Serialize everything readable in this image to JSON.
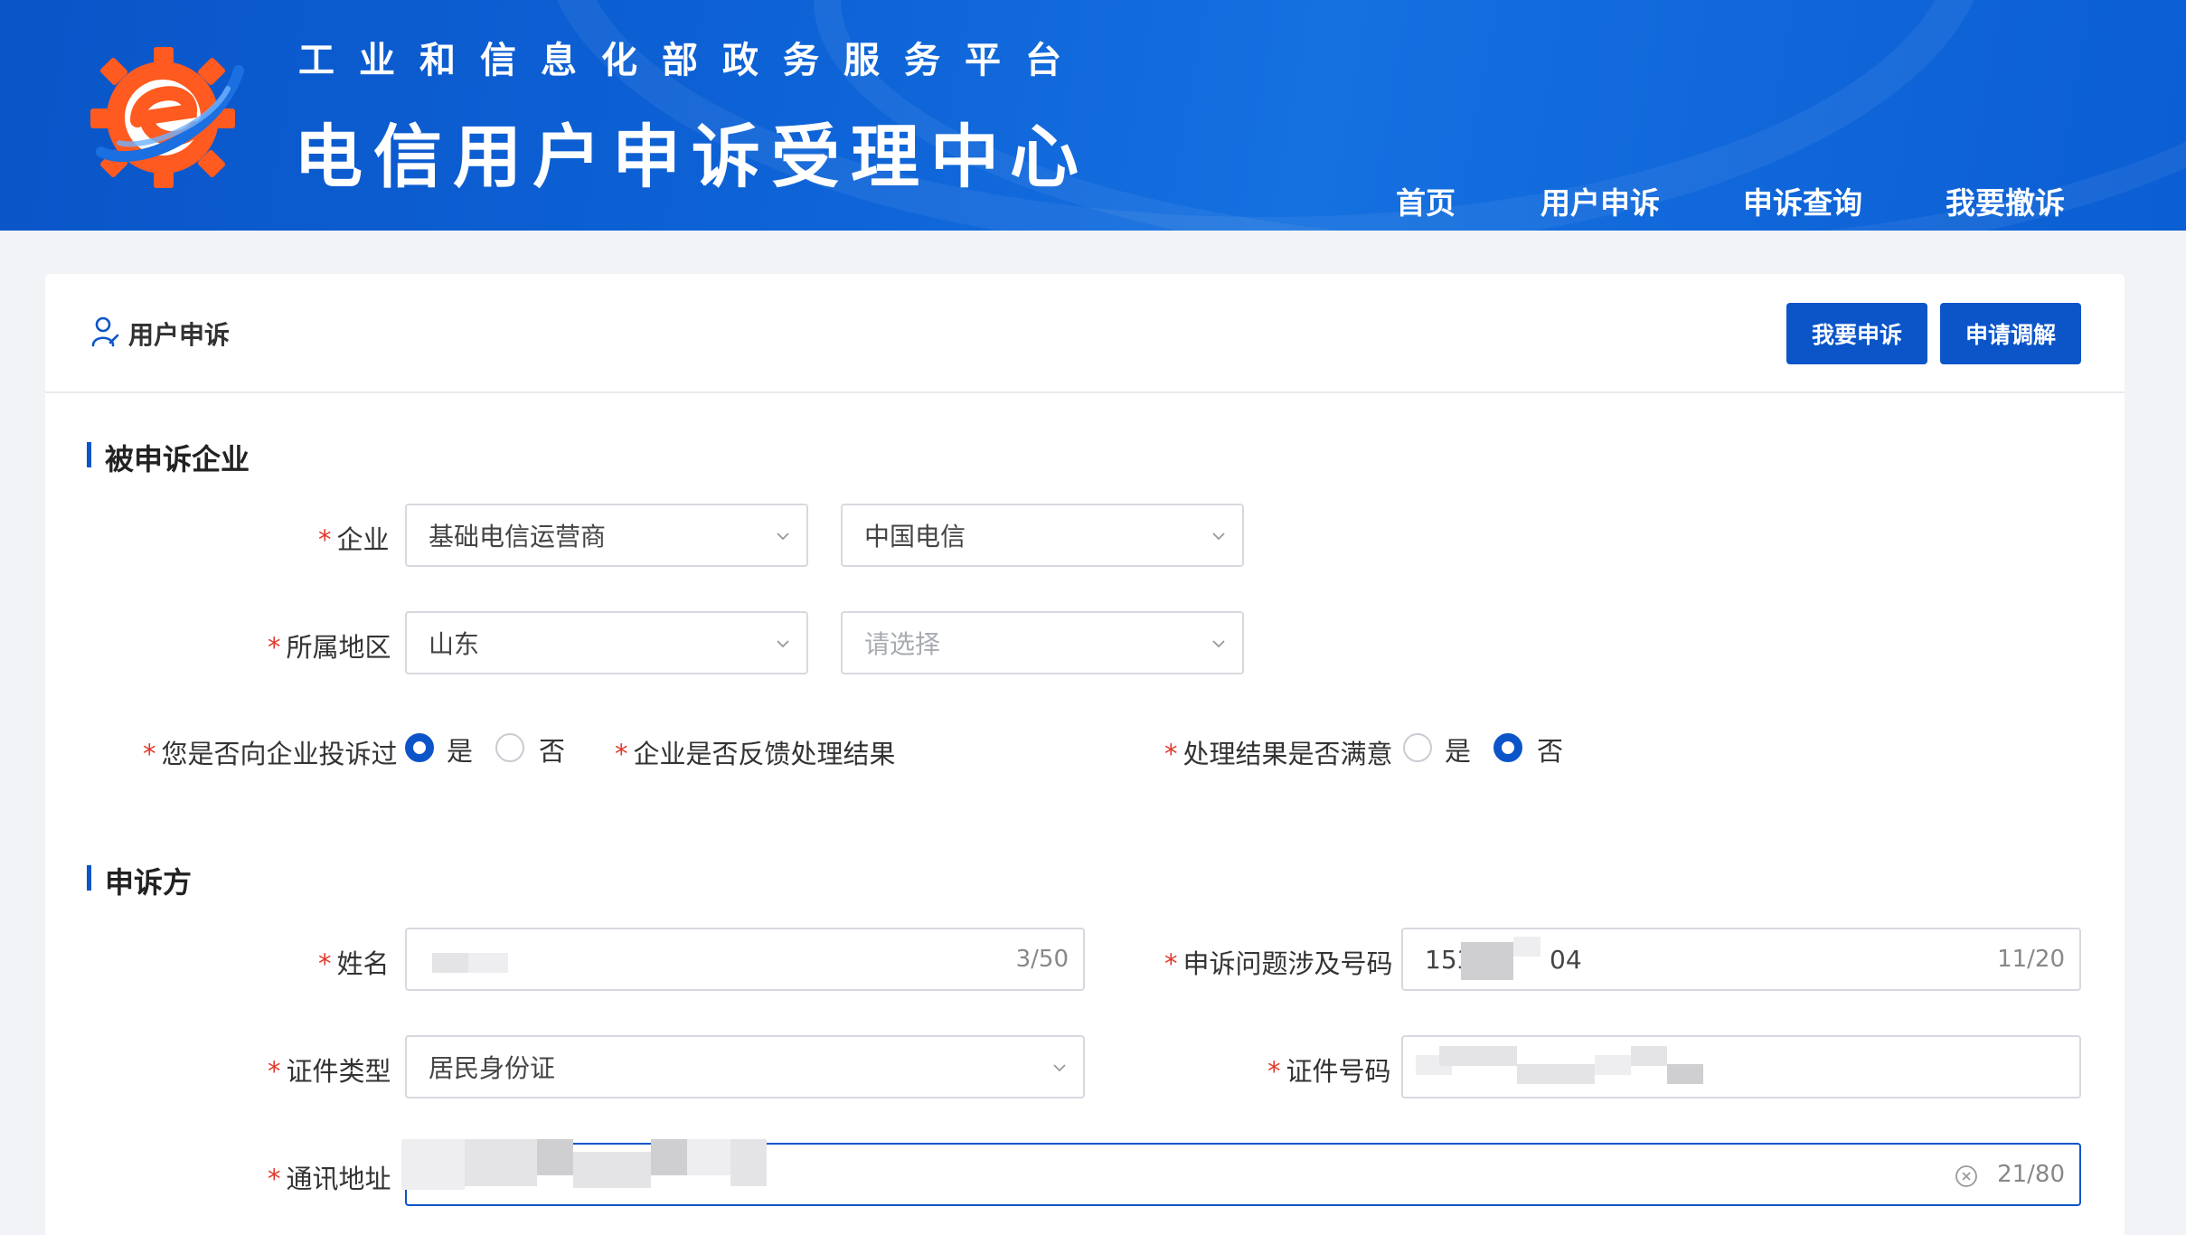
{
  "header": {
    "platform_title": "工业和信息化部政务服务平台",
    "center_title": "电信用户申诉受理中心",
    "nav": [
      "首页",
      "用户申诉",
      "申诉查询",
      "我要撤诉"
    ],
    "colors": {
      "header_bg": "#0b5ed3",
      "logo_orange": "#ff5a1f",
      "logo_blue": "#1b6fe0"
    }
  },
  "card": {
    "title": "用户申诉",
    "icon": "user-icon",
    "buttons": {
      "complain": "我要申诉",
      "mediation": "申请调解"
    }
  },
  "section1": {
    "title": "被申诉企业",
    "enterprise": {
      "label": "企业",
      "type_value": "基础电信运营商",
      "company_value": "中国电信"
    },
    "region": {
      "label": "所属地区",
      "province_value": "山东",
      "city_placeholder": "请选择"
    },
    "complained_before": {
      "label": "您是否向企业投诉过",
      "yes": "是",
      "no": "否",
      "selected": "是"
    },
    "feedback": {
      "label": "企业是否反馈处理结果"
    },
    "satisfied": {
      "label": "处理结果是否满意",
      "yes": "是",
      "no": "否",
      "selected": "否"
    }
  },
  "section2": {
    "title": "申诉方",
    "name": {
      "label": "姓名",
      "counter": "3/50"
    },
    "phone": {
      "label": "申诉问题涉及号码",
      "prefix": "153",
      "suffix": "04",
      "counter": "11/20"
    },
    "id_type": {
      "label": "证件类型",
      "value": "居民身份证"
    },
    "id_number": {
      "label": "证件号码"
    },
    "address": {
      "label": "通讯地址",
      "counter": "21/80"
    }
  },
  "accent_color": "#0b55c9",
  "required_color": "#e0392b"
}
